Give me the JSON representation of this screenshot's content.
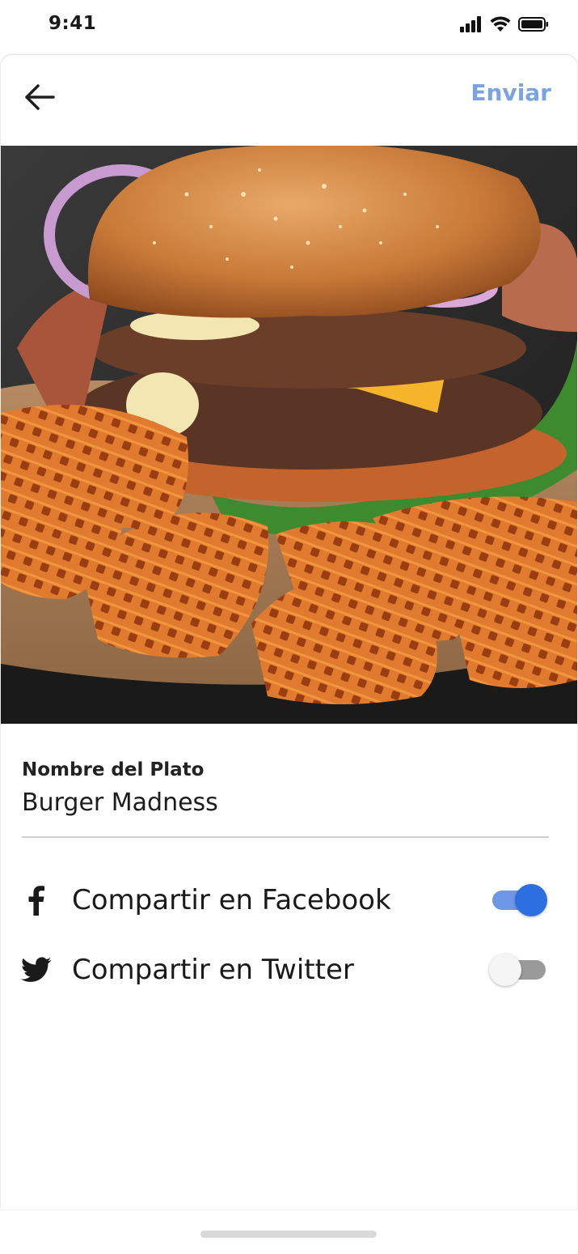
{
  "status_bar": {
    "time": "9:41"
  },
  "header": {
    "back_icon": "arrow-left-icon",
    "send_label": "Enviar",
    "send_color": "#7BA3E0"
  },
  "photo": {
    "subject": "burger-with-waffle-fries"
  },
  "dish_field": {
    "label": "Nombre del Plato",
    "value": "Burger Madness"
  },
  "share": [
    {
      "icon": "facebook-icon",
      "label": "Compartir en Facebook",
      "enabled": true
    },
    {
      "icon": "twitter-icon",
      "label": "Compartir en Twitter",
      "enabled": false
    }
  ],
  "colors": {
    "accent": "#2D6FE0",
    "accent_track": "#6E98E6"
  }
}
